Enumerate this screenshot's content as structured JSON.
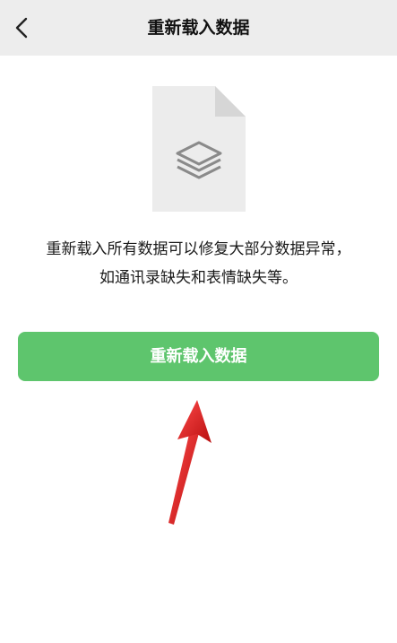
{
  "header": {
    "back_icon": "chevron-left-icon",
    "title": "重新载入数据"
  },
  "illustration": {
    "icon": "layers-document-icon"
  },
  "description": {
    "line1": "重新载入所有数据可以修复大部分数据异常，",
    "line2": "如通讯录缺失和表情缺失等。"
  },
  "action": {
    "button_label": "重新载入数据"
  },
  "annotation": {
    "icon": "red-arrow-pointer"
  },
  "colors": {
    "navbar_bg": "#ededed",
    "button_bg": "#5ec56d",
    "arrow": "#d81e1e"
  }
}
